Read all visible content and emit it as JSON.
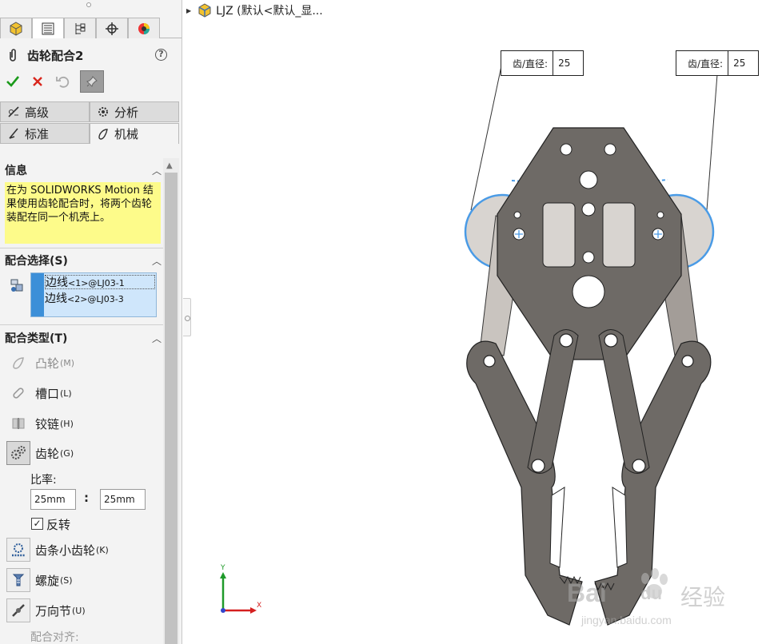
{
  "tree": {
    "name": "LJZ (默认<默认_显..."
  },
  "panel": {
    "title": "齿轮配合2",
    "mate_tabs": {
      "advanced": "高级",
      "analysis": "分析",
      "standard": "标准",
      "mechanical": "机械"
    },
    "info": {
      "header": "信息",
      "text": "在为 SOLIDWORKS Motion 结果使用齿轮配合时，将两个齿轮装配在同一个机壳上。"
    },
    "selection": {
      "header": "配合选择(S)",
      "items": [
        {
          "main": "边线",
          "sub": "<1>@LJ03-1"
        },
        {
          "main": "边线",
          "sub": "<2>@LJ03-3"
        }
      ]
    },
    "mate_types": {
      "header": "配合类型(T)",
      "cam": {
        "label": "凸轮",
        "key": "(M)"
      },
      "slot": {
        "label": "槽口",
        "key": "(L)"
      },
      "hinge": {
        "label": "铰链",
        "key": "(H)"
      },
      "gear": {
        "label": "齿轮",
        "key": "(G)"
      },
      "ratio_label": "比率:",
      "ratio_a": "25mm",
      "ratio_b": "25mm",
      "ratio_sep": ":",
      "reverse_label": "反转",
      "reverse_checked": true,
      "rack": {
        "label": "齿条小齿轮",
        "key": "(K)"
      },
      "screw": {
        "label": "螺旋",
        "key": "(S)"
      },
      "ujoint": {
        "label": "万向节",
        "key": "(U)"
      },
      "align_label": "配合对齐:"
    }
  },
  "callouts": [
    {
      "key": "齿/直径:",
      "value": "25"
    },
    {
      "key": "齿/直径:",
      "value": "25"
    }
  ],
  "triad": {
    "x": "X",
    "y": "Y"
  },
  "watermark": {
    "brand": "Bai",
    "brand2": "du",
    "cn": "经验",
    "url": "jingyan.baidu.com"
  },
  "colors": {
    "part": "#6e6a66",
    "link": "#a39d98",
    "highlight": "#3c8fd8",
    "info_bg": "#fdfb8a"
  }
}
